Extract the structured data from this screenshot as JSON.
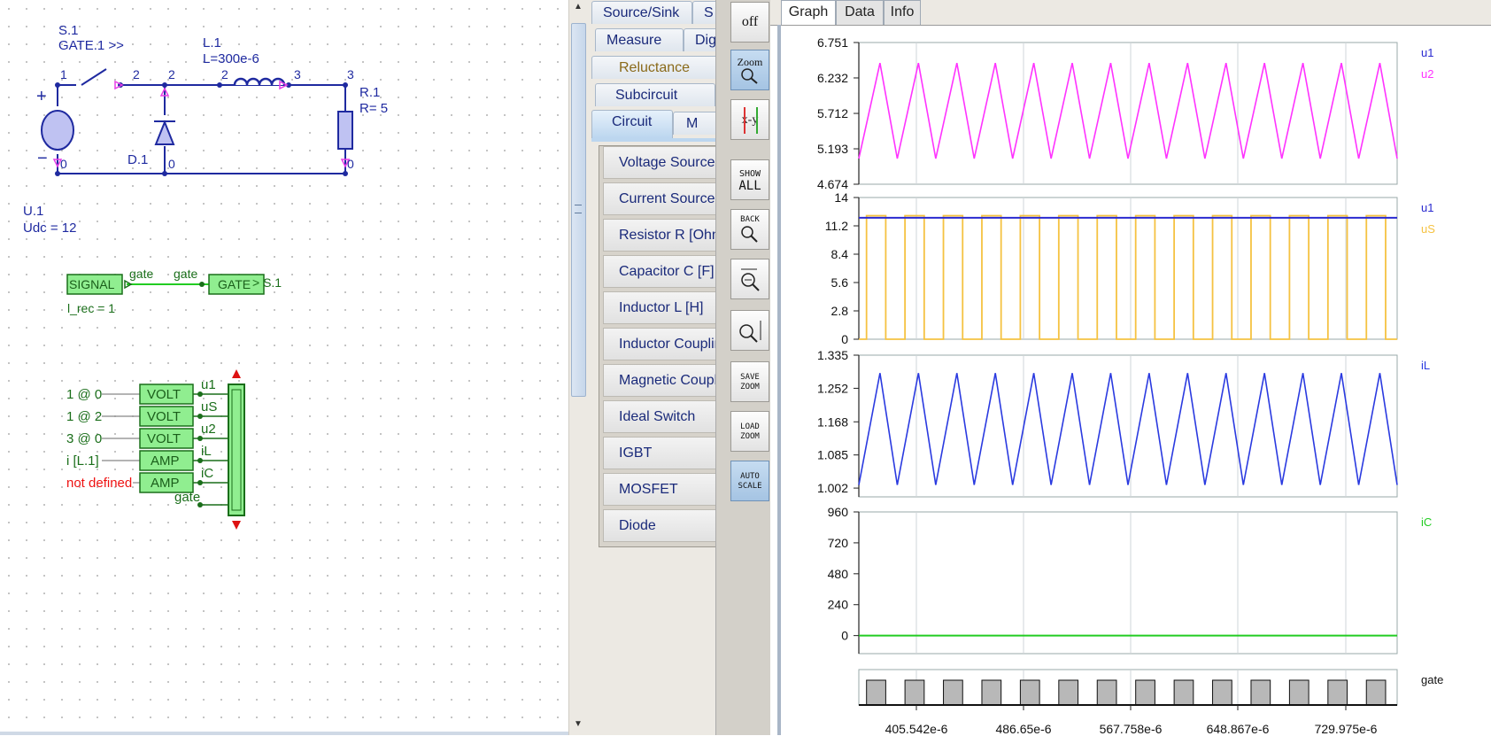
{
  "schematic": {
    "switch_label": "S.1",
    "switch_gate": "GATE.1 >>",
    "inductor_label": "L.1",
    "inductor_value": "L=300e-6",
    "resistor_label": "R.1",
    "resistor_value": "R= 5",
    "diode_label": "D.1",
    "source_label": "U.1",
    "source_value": "Udc = 12",
    "plus": "+",
    "minus": "−",
    "node_labels": [
      "1",
      "2",
      "2",
      "2",
      "3",
      "3",
      "0",
      "0",
      "0"
    ],
    "signal_block": "SIGNAL",
    "signal_param": "l_rec = 1",
    "wire_label_1": "gate",
    "wire_label_2": "gate",
    "gate_block": "GATE",
    "gate_target": "> S.1",
    "probes": [
      {
        "source": "1 @ 0",
        "block": "VOLT",
        "signal": "u1"
      },
      {
        "source": "1 @ 2",
        "block": "VOLT",
        "signal": "uS"
      },
      {
        "source": "3 @ 0",
        "block": "VOLT",
        "signal": "u2"
      },
      {
        "source": "i [L.1]",
        "block": "AMP",
        "signal": "iL"
      },
      {
        "source": "not defined",
        "block": "AMP",
        "signal": "iC"
      }
    ],
    "probe_extra_signal": "gate"
  },
  "library": {
    "tabs": [
      "Source/Sink",
      "S",
      "Measure",
      "Dig",
      "Reluctance",
      "Subcircuit",
      "Circuit",
      "M"
    ],
    "items": [
      "Voltage Source",
      "Current Source",
      "Resistor R [Ohm]",
      "Capacitor C [F]",
      "Inductor L [H]",
      "Inductor Coupling",
      "Magnetic Coupling",
      "Ideal Switch",
      "IGBT",
      "MOSFET",
      "Diode"
    ]
  },
  "toolbar": {
    "off": "off",
    "zoom": "Zoom",
    "xy": "x-y",
    "show_all": [
      "SHOW",
      "ALL"
    ],
    "back": "BACK",
    "save_zoom": [
      "SAVE",
      "ZOOM"
    ],
    "load_zoom": [
      "LOAD",
      "ZOOM"
    ],
    "auto_scale": [
      "AUTO",
      "SCALE"
    ]
  },
  "scope": {
    "tabs": [
      "Graph",
      "Data",
      "Info"
    ],
    "active_tab": "Graph",
    "x_ticks": [
      "405.542e-6",
      "486.65e-6",
      "567.758e-6",
      "648.867e-6",
      "729.975e-6"
    ],
    "colors": {
      "u1": "#2a2ad0",
      "u2": "#ff33ff",
      "uS": "#f5c242",
      "iL": "#2a3ae0",
      "iC": "#22cc22",
      "gate_fill": "#b8b8b8"
    }
  },
  "chart_data": [
    {
      "type": "line",
      "series": [
        {
          "name": "u1",
          "values": []
        },
        {
          "name": "u2",
          "shape": "triangle",
          "min": 5.05,
          "max": 6.45,
          "periods": 14
        }
      ],
      "yticks": [
        "6.751",
        "6.232",
        "5.712",
        "5.193",
        "4.674"
      ],
      "ylim": [
        4.674,
        6.751
      ],
      "grid": true
    },
    {
      "type": "line",
      "series": [
        {
          "name": "u1",
          "constant": 12
        },
        {
          "name": "uS",
          "shape": "square",
          "low": 0,
          "high": 12.2,
          "periods": 14,
          "duty": 0.5
        }
      ],
      "yticks": [
        "14",
        "11.2",
        "8.4",
        "5.6",
        "2.8",
        "0"
      ],
      "ylim": [
        0,
        14
      ],
      "grid": true
    },
    {
      "type": "line",
      "series": [
        {
          "name": "iL",
          "shape": "triangle",
          "min": 1.01,
          "max": 1.29,
          "periods": 14
        }
      ],
      "yticks": [
        "1.335",
        "1.252",
        "1.168",
        "1.085",
        "1.002"
      ],
      "ylim": [
        0.98,
        1.335
      ],
      "grid": true
    },
    {
      "type": "line",
      "series": [
        {
          "name": "iC",
          "constant": 0
        }
      ],
      "yticks": [
        "960",
        "720",
        "480",
        "240",
        "0"
      ],
      "ylim": [
        -140,
        960
      ],
      "grid": true
    },
    {
      "type": "area",
      "series": [
        {
          "name": "gate",
          "shape": "square",
          "periods": 14
        }
      ],
      "yticks": [],
      "grid": true
    }
  ]
}
